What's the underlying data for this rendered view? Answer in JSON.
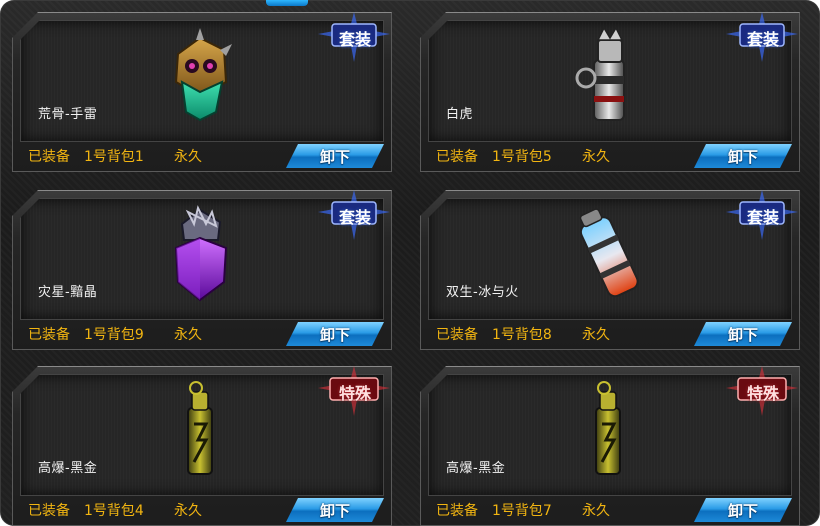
{
  "colors": {
    "status_text": "#f2b511",
    "name_text": "#f2f2f2",
    "button": "#1e8ad8",
    "badge_suit": "#3a6cff",
    "badge_special": "#e0303a"
  },
  "cards": [
    {
      "name": "荒骨-手雷",
      "status": "已装备",
      "bag": "1号背包1",
      "duration": "永久",
      "button": "卸下",
      "badge": "套装",
      "badge_type": "suit",
      "art": "skull-grenade-icon"
    },
    {
      "name": "白虎",
      "status": "已装备",
      "bag": "1号背包5",
      "duration": "永久",
      "button": "卸下",
      "badge": "套装",
      "badge_type": "suit",
      "art": "tiger-grenade-icon"
    },
    {
      "name": "灾星-黯晶",
      "status": "已装备",
      "bag": "1号背包9",
      "duration": "永久",
      "button": "卸下",
      "badge": "套装",
      "badge_type": "suit",
      "art": "crystal-grenade-icon"
    },
    {
      "name": "双生-冰与火",
      "status": "已装备",
      "bag": "1号背包8",
      "duration": "永久",
      "button": "卸下",
      "badge": "套装",
      "badge_type": "suit",
      "art": "ice-fire-grenade-icon"
    },
    {
      "name": "高爆-黑金",
      "status": "已装备",
      "bag": "1号背包4",
      "duration": "永久",
      "button": "卸下",
      "badge": "特殊",
      "badge_type": "special",
      "art": "gold-grenade-icon"
    },
    {
      "name": "高爆-黑金",
      "status": "已装备",
      "bag": "1号背包7",
      "duration": "永久",
      "button": "卸下",
      "badge": "特殊",
      "badge_type": "special",
      "art": "gold-grenade-icon"
    }
  ]
}
